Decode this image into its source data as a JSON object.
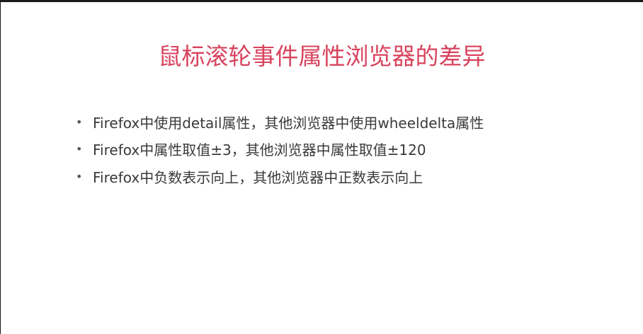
{
  "slide": {
    "title": "鼠标滚轮事件属性浏览器的差异",
    "bullet_symbol": "•",
    "bullets": [
      "Firefox中使用detail属性，其他浏览器中使用wheeldelta属性",
      "Firefox中属性取值±3，其他浏览器中属性取值±120",
      "Firefox中负数表示向上，其他浏览器中正数表示向上"
    ],
    "colors": {
      "title": "#d8435d",
      "text": "#3a3a3a"
    }
  }
}
